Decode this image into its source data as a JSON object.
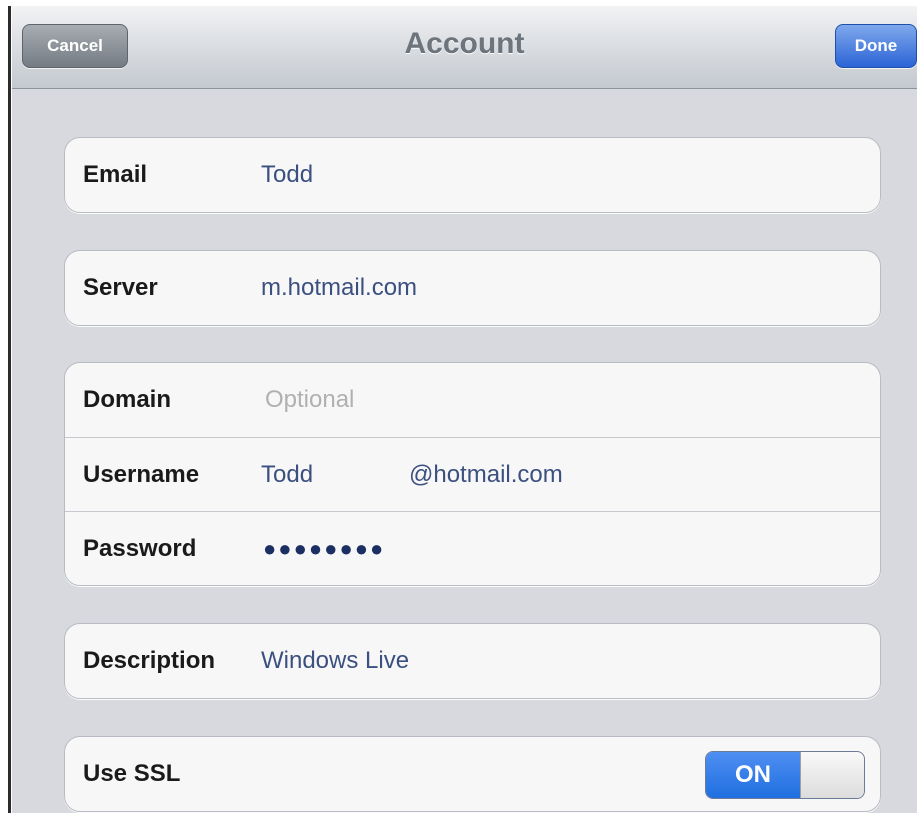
{
  "navbar": {
    "title": "Account",
    "cancel_label": "Cancel",
    "done_label": "Done"
  },
  "email": {
    "label": "Email",
    "value": "Todd"
  },
  "server": {
    "label": "Server",
    "value": "m.hotmail.com"
  },
  "domain": {
    "label": "Domain",
    "placeholder": "Optional"
  },
  "username": {
    "label": "Username",
    "value_user": "Todd",
    "value_domain": "@hotmail.com"
  },
  "password": {
    "label": "Password",
    "value": "●●●●●●●●"
  },
  "description": {
    "label": "Description",
    "value": "Windows Live"
  },
  "ssl": {
    "label": "Use SSL",
    "state": "ON"
  },
  "colors": {
    "done_button": "#2b64d6",
    "value_text": "#3b4f81",
    "switch_on": "#1f6fe0"
  }
}
